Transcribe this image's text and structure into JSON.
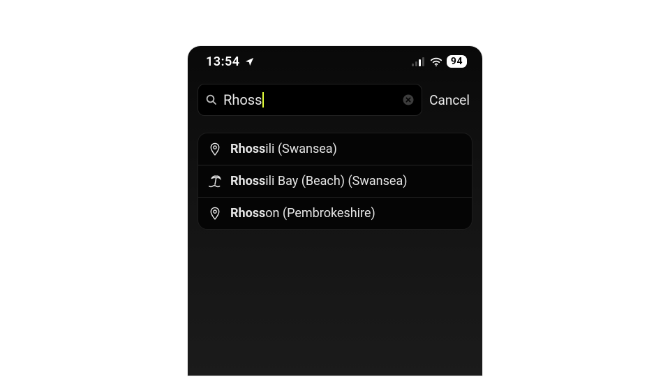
{
  "statusbar": {
    "time": "13:54",
    "battery": "94"
  },
  "search": {
    "query": "Rhoss",
    "cancel_label": "Cancel"
  },
  "results": [
    {
      "icon": "pin",
      "bold": "Rhoss",
      "rest": "ili (Swansea)"
    },
    {
      "icon": "beach",
      "bold": "Rhoss",
      "rest": "ili Bay (Beach) (Swansea)"
    },
    {
      "icon": "pin",
      "bold": "Rhoss",
      "rest": "on (Pembrokeshire)"
    }
  ]
}
